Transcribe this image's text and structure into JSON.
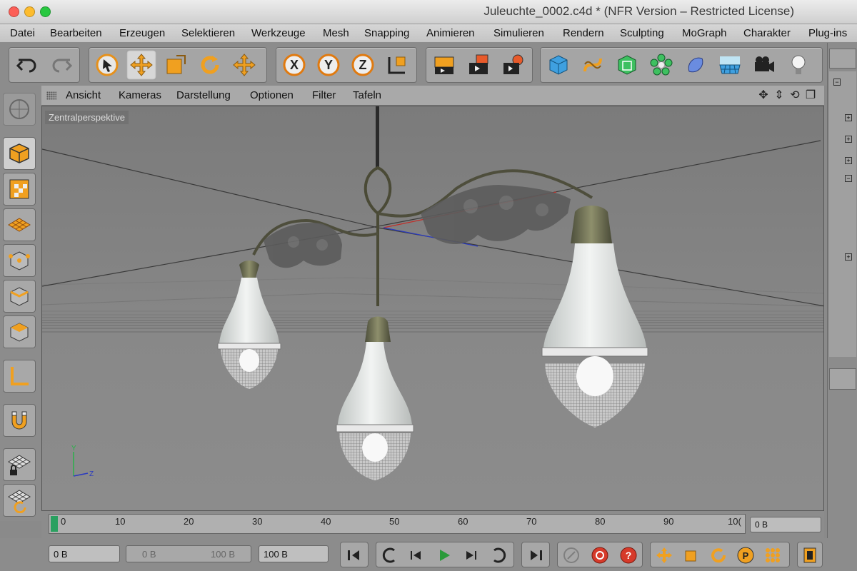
{
  "window": {
    "title": "Juleuchte_0002.c4d * (NFR Version – Restricted License)"
  },
  "menu": [
    "Datei",
    "Bearbeiten",
    "Erzeugen",
    "Selektieren",
    "Werkzeuge",
    "Mesh",
    "Snapping",
    "Animieren",
    "Simulieren",
    "Rendern",
    "Sculpting",
    "MoGraph",
    "Charakter",
    "Plug-ins"
  ],
  "viewport": {
    "menu": [
      "Ansicht",
      "Kameras",
      "Darstellung",
      "Optionen",
      "Filter",
      "Tafeln"
    ],
    "label": "Zentralperspektive",
    "axis_labels": [
      "Y",
      "Z"
    ]
  },
  "toolbar": {
    "icons": [
      "undo-icon",
      "redo-icon",
      "select-arrow-icon",
      "move-icon",
      "scale-icon",
      "rotate-icon",
      "live-move-icon",
      "x-axis-icon",
      "y-axis-icon",
      "z-axis-icon",
      "coordinate-system-icon",
      "render-view-icon",
      "render-picture-viewer-icon",
      "render-settings-icon",
      "cube-icon",
      "spline-icon",
      "subdivision-icon",
      "mograph-cloner-icon",
      "deformer-icon",
      "floor-icon",
      "camera-icon",
      "light-icon"
    ],
    "axis_letters": [
      "X",
      "Y",
      "Z"
    ]
  },
  "timeline": {
    "ticks": [
      "0",
      "10",
      "20",
      "30",
      "40",
      "50",
      "60",
      "70",
      "80",
      "90",
      "10("
    ],
    "current_frame": "0 B"
  },
  "transport": {
    "start_field": "0 B",
    "range_min": "0 B",
    "range_max": "100 B",
    "end_field": "100 B"
  },
  "colors": {
    "accent_orange": "#f0a020",
    "toolbar_bg": "#8c8c8c",
    "viewport_bg": "#858585",
    "play_green": "#2a9a3a"
  }
}
